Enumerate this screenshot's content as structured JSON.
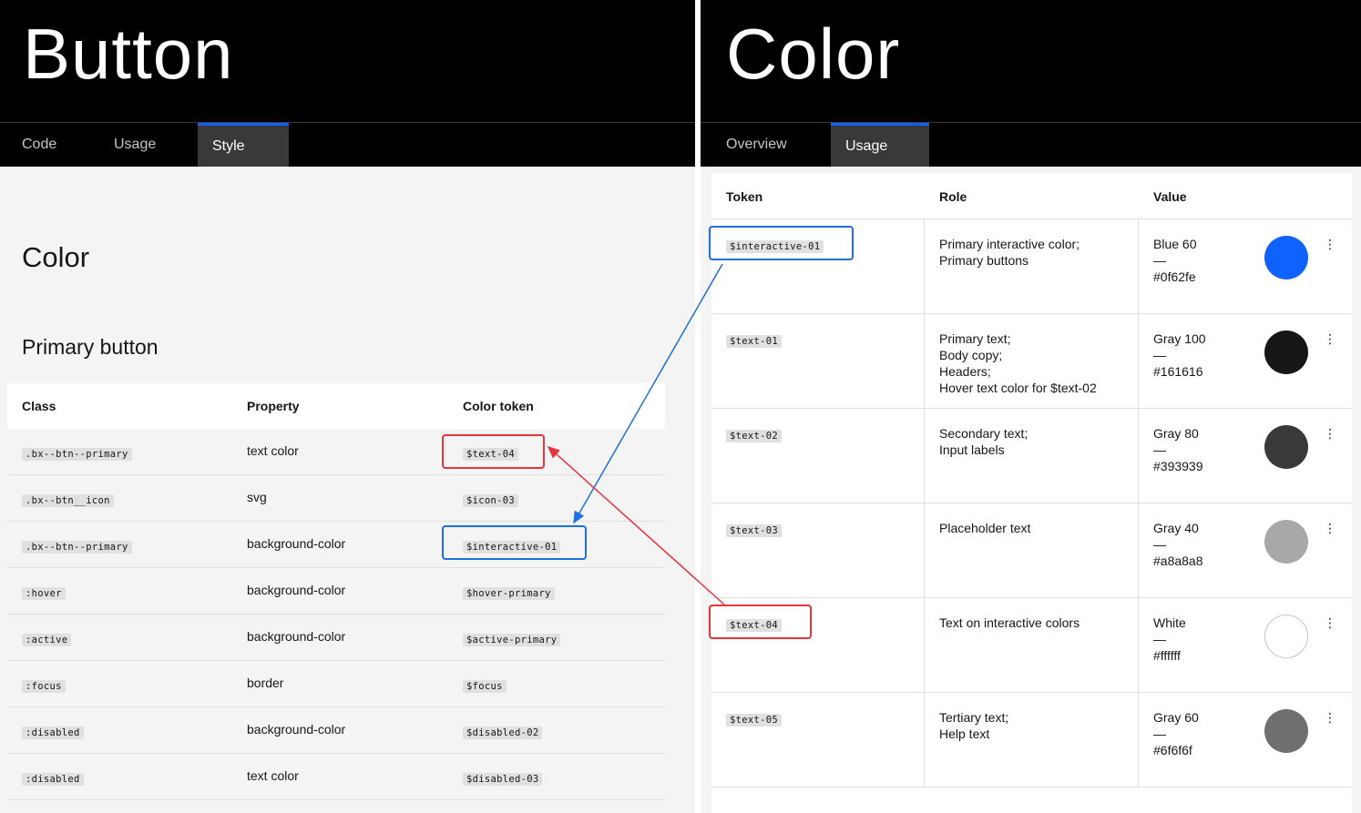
{
  "left": {
    "title": "Button",
    "tabs": [
      "Code",
      "Usage",
      "Style"
    ],
    "active_tab": "Style",
    "section_title": "Color",
    "sub_title": "Primary button",
    "table": {
      "headers": [
        "Class",
        "Property",
        "Color token"
      ],
      "rows": [
        {
          "class": ".bx--btn--primary",
          "property": "text color",
          "token": "$text-04"
        },
        {
          "class": ".bx--btn__icon",
          "property": "svg",
          "token": "$icon-03"
        },
        {
          "class": ".bx--btn--primary",
          "property": "background-color",
          "token": "$interactive-01"
        },
        {
          "class": ":hover",
          "property": "background-color",
          "token": "$hover-primary"
        },
        {
          "class": ":active",
          "property": "background-color",
          "token": "$active-primary"
        },
        {
          "class": ":focus",
          "property": "border",
          "token": "$focus"
        },
        {
          "class": ":disabled",
          "property": "background-color",
          "token": "$disabled-02"
        },
        {
          "class": ":disabled",
          "property": "text color",
          "token": "$disabled-03"
        }
      ]
    }
  },
  "right": {
    "title": "Color",
    "tabs": [
      "Overview",
      "Usage"
    ],
    "active_tab": "Usage",
    "table": {
      "headers": [
        "Token",
        "Role",
        "Value"
      ],
      "rows": [
        {
          "token": "$interactive-01",
          "role": [
            "Primary interactive color;",
            "Primary buttons"
          ],
          "name": "Blue 60",
          "dash": "—",
          "hex": "#0f62fe",
          "swatch": "#0f62fe",
          "menu": "⋮"
        },
        {
          "token": "$text-01",
          "role": [
            "Primary text;",
            "Body copy;",
            "Headers;",
            "Hover text color for $text-02"
          ],
          "name": "Gray 100",
          "dash": "—",
          "hex": "#161616",
          "swatch": "#161616",
          "menu": "⋮"
        },
        {
          "token": "$text-02",
          "role": [
            "Secondary text;",
            "Input labels"
          ],
          "name": "Gray 80",
          "dash": "—",
          "hex": "#393939",
          "swatch": "#393939",
          "menu": "⋮"
        },
        {
          "token": "$text-03",
          "role": [
            "Placeholder text"
          ],
          "name": "Gray 40",
          "dash": "—",
          "hex": "#a8a8a8",
          "swatch": "#a8a8a8",
          "menu": "⋮"
        },
        {
          "token": "$text-04",
          "role": [
            "Text on interactive colors"
          ],
          "name": "White",
          "dash": "—",
          "hex": "#ffffff",
          "swatch": "#ffffff",
          "menu": "⋮"
        },
        {
          "token": "$text-05",
          "role": [
            "Tertiary text;",
            "Help text"
          ],
          "name": "Gray 60",
          "dash": "—",
          "hex": "#6f6f6f",
          "swatch": "#6f6f6f",
          "menu": "⋮"
        }
      ]
    }
  },
  "annotation_colors": {
    "red": "#e8343a",
    "blue": "#1f6fe0",
    "tab_accent": "#0f62fe"
  }
}
